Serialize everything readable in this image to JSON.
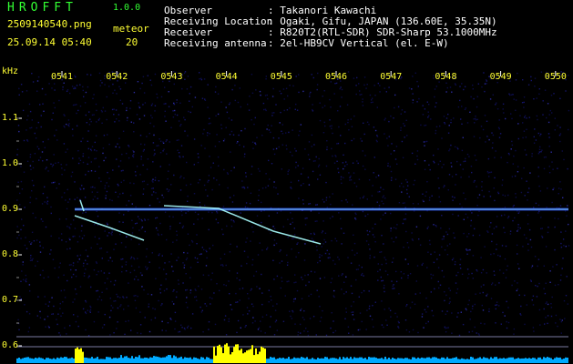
{
  "header": {
    "logo": "HROFFT",
    "version": "1.0.0",
    "filename": "2509140540.png",
    "datetime": "25.09.14 05:40",
    "meteor_label": "meteor",
    "meteor_count": "20"
  },
  "info": [
    {
      "label": "Observer",
      "value": ": Takanori Kawachi"
    },
    {
      "label": "Receiving Location",
      "value": ": Ogaki, Gifu, JAPAN (136.60E, 35.35N)"
    },
    {
      "label": "Receiver",
      "value": ": R820T2(RTL-SDR) SDR-Sharp 53.1000MHz"
    },
    {
      "label": "Receiving antenna",
      "value": ": 2el-HB9CV Vertical (el. E-W)"
    }
  ],
  "y_unit": "kHz",
  "time_ticks": [
    "0541",
    "0542",
    "0543",
    "0544",
    "0545",
    "0546",
    "0547",
    "0548",
    "0549",
    "0550"
  ],
  "freq_ticks": [
    "1.1",
    "1.0",
    "0.9",
    "0.8",
    "0.7",
    "0.6"
  ],
  "colors": {
    "background": "#000000",
    "text_green": "#33ff33",
    "text_yellow": "#ffff33",
    "text_white": "#ffffff",
    "noise": "#0a0a4a",
    "carrier": "#7fd4ff",
    "meteor": "#aaffff",
    "level_bar": "#00aaff",
    "level_peak": "#ffff00"
  }
}
